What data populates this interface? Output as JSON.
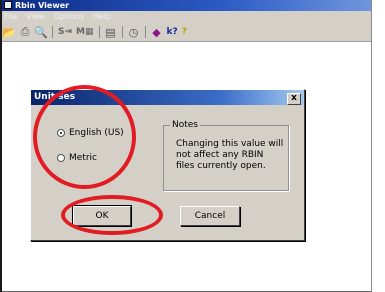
{
  "window": {
    "title": "Rbin Viewer"
  },
  "menubar": {
    "items": [
      "File",
      "View",
      "Options",
      "Help"
    ]
  },
  "toolbar": {
    "buttons": [
      {
        "icon": "open-folder-icon",
        "glyph": "📂"
      },
      {
        "icon": "print-icon",
        "glyph": "⎙"
      },
      {
        "icon": "print-preview-icon",
        "glyph": "🔍"
      },
      {
        "icon": "shift-left-icon",
        "text": "S⇥"
      },
      {
        "icon": "grid-icon",
        "text": "M▦"
      },
      {
        "icon": "table-icon",
        "glyph": "▤"
      },
      {
        "icon": "clock-icon",
        "glyph": "◷"
      },
      {
        "icon": "diamond-icon",
        "glyph": "◆"
      },
      {
        "icon": "whats-this-icon",
        "text": "k?"
      },
      {
        "icon": "help-icon",
        "text": "?"
      }
    ]
  },
  "dialog": {
    "title": "Unit ses",
    "close_label": "x",
    "options": [
      {
        "label": "English (US)",
        "selected": true
      },
      {
        "label": "Metric",
        "selected": false
      }
    ],
    "notes_legend": "Notes",
    "notes_text": "Changing this value will not affect any RBIN files currently open.",
    "ok_label": "OK",
    "cancel_label": "Cancel"
  },
  "colors": {
    "highlight": "#e31b23",
    "titlebar": "#0a246a",
    "dialog_bg": "#d4d0c8"
  }
}
